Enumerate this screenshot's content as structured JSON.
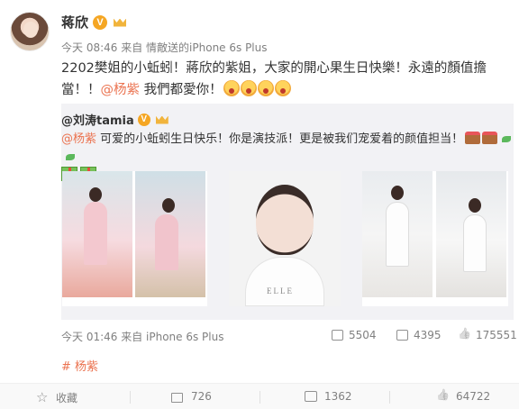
{
  "post": {
    "author": "蒋欣",
    "meta_time": "今天 08:46 来自",
    "meta_source": "情敵送的iPhone 6s Plus",
    "text_line1": "2202樊姐的小蚯蚓！蔣欣的紫姐，大家的開心果生日快樂！永遠的顏值擔",
    "text_line2_prefix": "當！！",
    "mention": "@杨紫",
    "text_line2_suffix": " 我們都愛你！",
    "emoji_count": 4
  },
  "repost": {
    "author": "@刘涛tamia",
    "mention": "@杨紫",
    "text": " 可爱的小蚯蚓生日快乐！你是演技派！更是被我们宠爱着的颜值担当！",
    "images": [
      {
        "name": "pink-dress-photos"
      },
      {
        "name": "elle-portrait",
        "caption": "ELLE"
      },
      {
        "name": "white-dress-photos"
      }
    ],
    "meta": "今天 01:46 来自 iPhone 6s Plus",
    "reposts": "5504",
    "comments": "4395",
    "likes": "175551"
  },
  "tag": "# 杨紫",
  "actions": {
    "favorite": "收藏",
    "repost_count": "726",
    "comment_count": "1362",
    "like_count": "64722"
  },
  "colors": {
    "link": "#eb7350",
    "repost_bg": "#f2f2f5",
    "badge": "#f5a623"
  },
  "icons": [
    "verified-badge",
    "vip-crown",
    "emoji-face",
    "cake",
    "gift",
    "repost-icon",
    "comment-icon",
    "like-icon",
    "star-icon"
  ]
}
